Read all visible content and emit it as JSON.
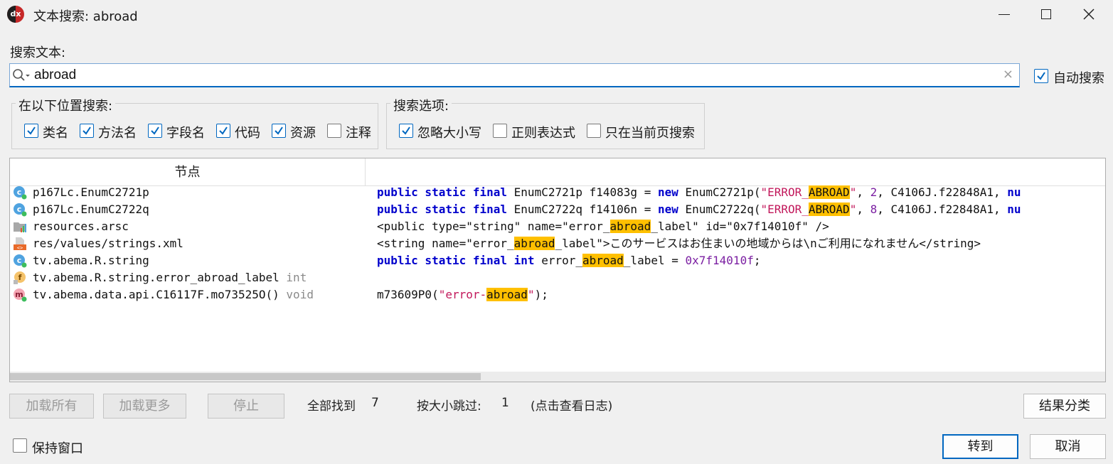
{
  "window": {
    "title": "文本搜索: abroad"
  },
  "search": {
    "label": "搜索文本:",
    "value": "abroad",
    "auto_search_label": "自动搜索"
  },
  "scope": {
    "title": "在以下位置搜索:",
    "items": [
      {
        "label": "类名",
        "checked": true
      },
      {
        "label": "方法名",
        "checked": true
      },
      {
        "label": "字段名",
        "checked": true
      },
      {
        "label": "代码",
        "checked": true
      },
      {
        "label": "资源",
        "checked": true
      },
      {
        "label": "注释",
        "checked": false
      }
    ]
  },
  "options": {
    "title": "搜索选项:",
    "items": [
      {
        "label": "忽略大小写",
        "checked": true
      },
      {
        "label": "正则表达式",
        "checked": false
      },
      {
        "label": "只在当前页搜索",
        "checked": false
      }
    ]
  },
  "results": {
    "header_node": "节点",
    "rows": [
      {
        "icon": "class-icon",
        "node": "p167Lc.EnumC2721p",
        "type": "",
        "code": [
          [
            "kw",
            "public static final"
          ],
          [
            "t",
            " EnumC2721p f14083g = "
          ],
          [
            "kw",
            "new"
          ],
          [
            "t",
            " EnumC2721p("
          ],
          [
            "str",
            "\"ERROR_"
          ],
          [
            "hl",
            "ABROAD"
          ],
          [
            "str",
            "\""
          ],
          [
            "t",
            ", "
          ],
          [
            "num",
            "2"
          ],
          [
            "t",
            ", C4106J.f22848A1, "
          ],
          [
            "kw",
            "nu"
          ]
        ]
      },
      {
        "icon": "class-icon",
        "node": "p167Lc.EnumC2722q",
        "type": "",
        "code": [
          [
            "kw",
            "public static final"
          ],
          [
            "t",
            " EnumC2722q f14106n = "
          ],
          [
            "kw",
            "new"
          ],
          [
            "t",
            " EnumC2722q("
          ],
          [
            "str",
            "\"ERROR_"
          ],
          [
            "hl",
            "ABROAD"
          ],
          [
            "str",
            "\""
          ],
          [
            "t",
            ", "
          ],
          [
            "num",
            "8"
          ],
          [
            "t",
            ", C4106J.f22848A1, "
          ],
          [
            "kw",
            "nu"
          ]
        ]
      },
      {
        "icon": "resource-file-icon",
        "node": "resources.arsc",
        "type": "",
        "code": [
          [
            "t",
            "<public type=\"string\" name=\"error_"
          ],
          [
            "hl",
            "abroad"
          ],
          [
            "t",
            "_label\" id=\"0x7f14010f\" />"
          ]
        ]
      },
      {
        "icon": "xml-file-icon",
        "node": "res/values/strings.xml",
        "type": "",
        "code": [
          [
            "t",
            "<string name=\"error_"
          ],
          [
            "hl",
            "abroad"
          ],
          [
            "t",
            "_label\">このサービスはお住まいの地域からは\\nご利用になれません</string>"
          ]
        ]
      },
      {
        "icon": "class-icon",
        "node": "tv.abema.R.string",
        "type": "",
        "code": [
          [
            "kw",
            "public static final int"
          ],
          [
            "t",
            " error_"
          ],
          [
            "hl",
            "abroad"
          ],
          [
            "t",
            "_label = "
          ],
          [
            "num",
            "0x7f14010f"
          ],
          [
            "t",
            ";"
          ]
        ]
      },
      {
        "icon": "field-icon",
        "node": "tv.abema.R.string.error_abroad_label",
        "type": "int",
        "code": []
      },
      {
        "icon": "method-icon",
        "node": "tv.abema.data.api.C16117F.mo73525O()",
        "type": "void",
        "code": [
          [
            "t",
            "m73609P0("
          ],
          [
            "str",
            "\"error-"
          ],
          [
            "hl",
            "abroad"
          ],
          [
            "str",
            "\""
          ],
          [
            "t",
            ");"
          ]
        ]
      }
    ]
  },
  "footer": {
    "load_all": "加载所有",
    "load_more": "加载更多",
    "stop": "停止",
    "found_label": "全部找到",
    "found_count": "7",
    "skipped_label": "按大小跳过:",
    "skipped_count": "1",
    "log_hint": "(点击查看日志)",
    "group_results": "结果分类",
    "keep_window": "保持窗口",
    "goto": "转到",
    "cancel": "取消"
  },
  "colors": {
    "accent": "#0067c0",
    "highlight": "#ffc000",
    "keyword": "#0000cc",
    "string": "#c2185b",
    "number": "#7b1fa2"
  }
}
